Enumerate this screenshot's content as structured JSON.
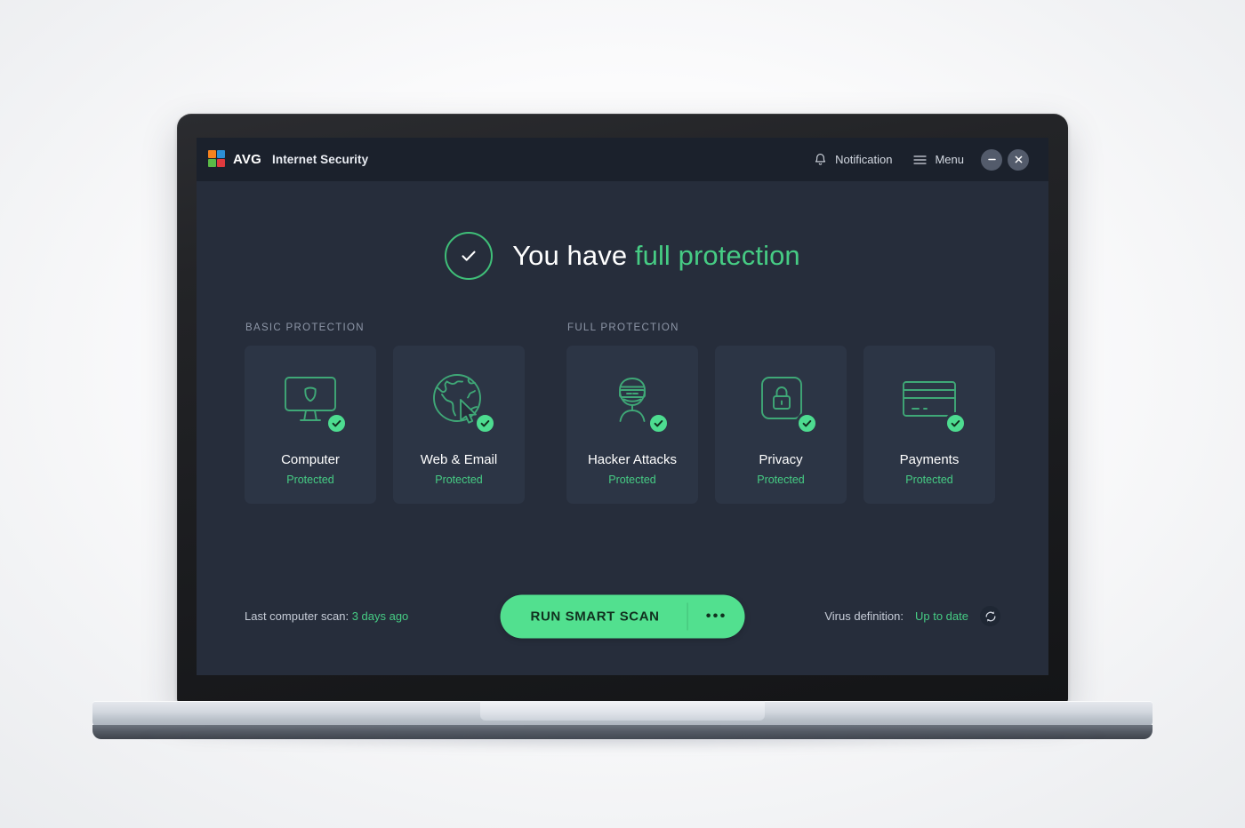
{
  "window": {
    "brand_mark": "avg-logo",
    "brand_name": "AVG",
    "product_name": "Internet Security",
    "notification_label": "Notification",
    "menu_label": "Menu",
    "minimize_glyph": "—",
    "close_glyph": "✕"
  },
  "status": {
    "icon": "check-circle-icon",
    "title_prefix": "You have ",
    "title_highlight": "full protection",
    "accent_color": "#46cc84"
  },
  "sections": [
    {
      "label": "BASIC PROTECTION",
      "tiles": [
        {
          "icon": "computer-monitor-shield-icon",
          "name": "Computer",
          "status": "Protected"
        },
        {
          "icon": "globe-cursor-icon",
          "name": "Web & Email",
          "status": "Protected"
        }
      ]
    },
    {
      "label": "FULL PROTECTION",
      "tiles": [
        {
          "icon": "masked-hacker-icon",
          "name": "Hacker Attacks",
          "status": "Protected"
        },
        {
          "icon": "padlock-square-icon",
          "name": "Privacy",
          "status": "Protected"
        },
        {
          "icon": "credit-card-icon",
          "name": "Payments",
          "status": "Protected"
        }
      ]
    }
  ],
  "footer": {
    "last_scan_label": "Last computer scan:",
    "last_scan_value": "3 days ago",
    "scan_button_label": "RUN SMART SCAN",
    "scan_more_glyph": "•••",
    "virus_def_label": "Virus definition:",
    "virus_def_value": "Up to date",
    "refresh_icon": "refresh-icon"
  },
  "theme": {
    "screen_bg": "#262d3b",
    "titlebar_bg": "#1b212c",
    "tile_bg": "#2c3545",
    "green": "#46cc84",
    "button_green": "#52e08f",
    "icon_stroke": "#3fa877"
  }
}
